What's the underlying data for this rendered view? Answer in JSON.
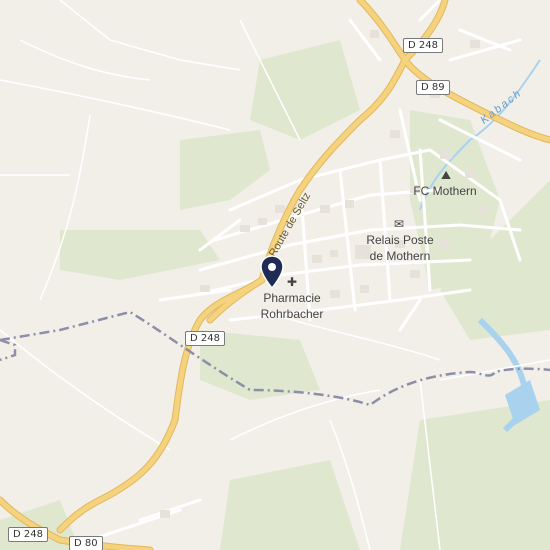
{
  "map": {
    "route_shields": [
      "D 248",
      "D 89",
      "D 248",
      "D 248",
      "D 80"
    ],
    "road_name": "Route de Seltz",
    "waterway": "Kabach",
    "places": [
      {
        "name": "FC Mothern",
        "icon": "stadium-icon"
      },
      {
        "name": "Relais Poste de Mothern",
        "icon": "post-office-icon"
      },
      {
        "name": "Pharmacie Rohrbacher",
        "icon": "pharmacy-icon"
      }
    ],
    "pin_icon": "location-pin-icon",
    "colors": {
      "background": "#f2efe9",
      "main_road": "#f5d27e",
      "road_casing": "#e2b85a",
      "minor_road": "#ffffff",
      "water": "#a9d2ef",
      "green": "#dfe8cf",
      "border": "#8c8fa8",
      "pin": "#1d2b55"
    }
  }
}
